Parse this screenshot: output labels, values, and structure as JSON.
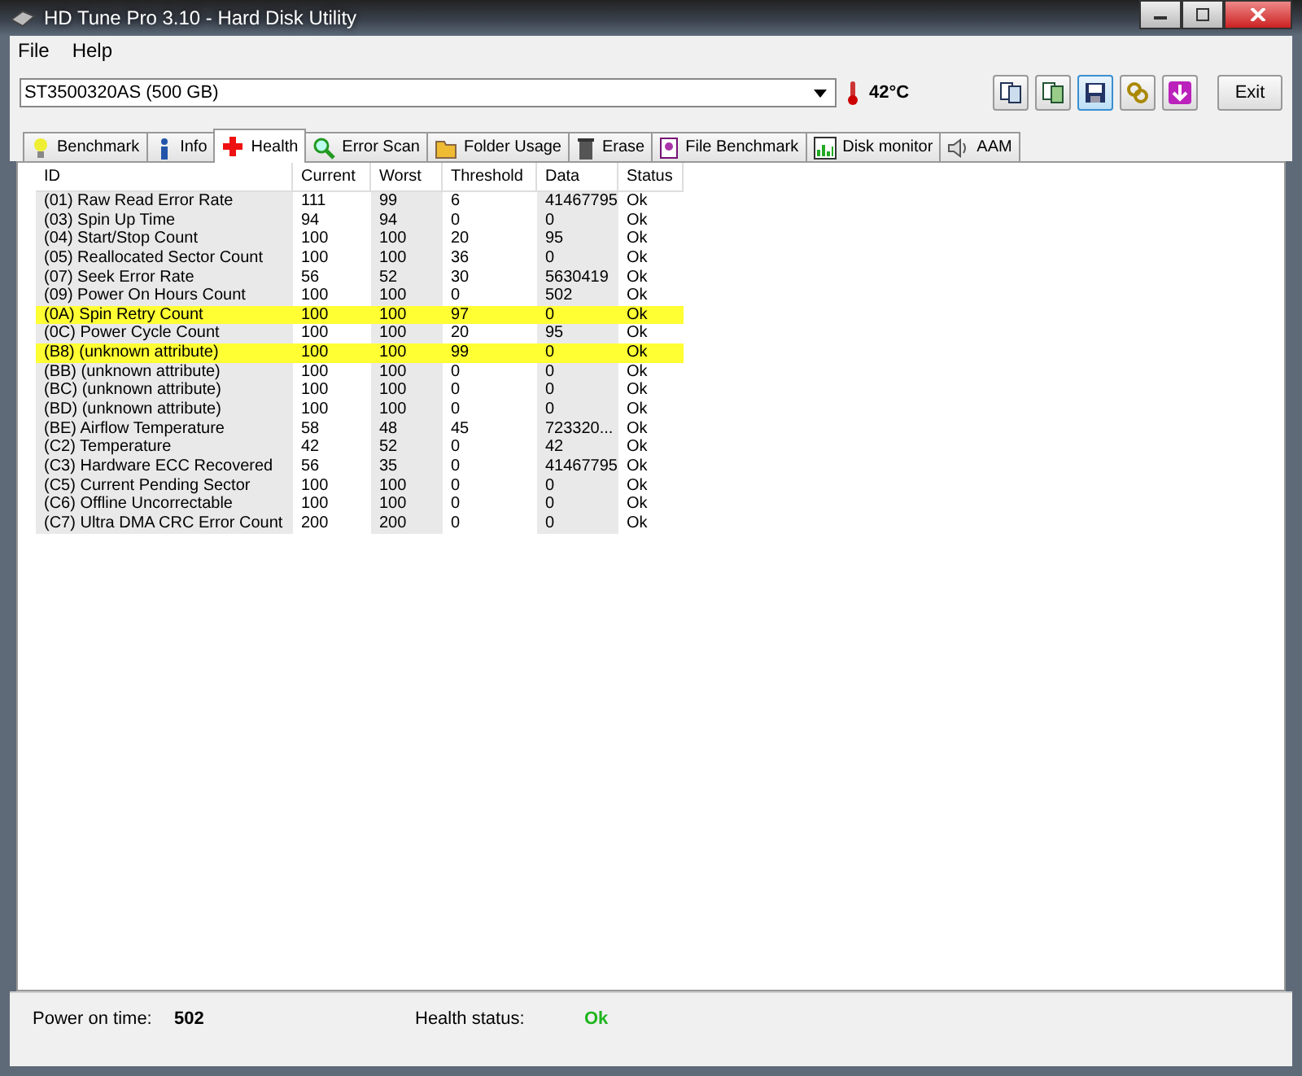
{
  "window": {
    "title": "HD Tune Pro 3.10 - Hard Disk Utility"
  },
  "menu": [
    "File",
    "Help"
  ],
  "drive": {
    "value": "ST3500320AS (500 GB)",
    "temperature": "42°C"
  },
  "toolbar": {
    "buttons": [
      {
        "highlighted": false
      },
      {
        "highlighted": false
      },
      {
        "highlighted": true
      },
      {
        "highlighted": false
      },
      {
        "highlighted": false
      }
    ],
    "exit": "Exit"
  },
  "tabs": [
    {
      "label": "Benchmark",
      "selected": false
    },
    {
      "label": "Info",
      "selected": false
    },
    {
      "label": "Health",
      "selected": true
    },
    {
      "label": "Error Scan",
      "selected": false
    },
    {
      "label": "Folder Usage",
      "selected": false
    },
    {
      "label": "Erase",
      "selected": false
    },
    {
      "label": "File Benchmark",
      "selected": false
    },
    {
      "label": "Disk monitor",
      "selected": false
    },
    {
      "label": "AAM",
      "selected": false
    }
  ],
  "table": {
    "columns": [
      "ID",
      "Current",
      "Worst",
      "Threshold",
      "Data",
      "Status"
    ],
    "rows": [
      {
        "cells": [
          "(01) Raw Read Error Rate",
          "111",
          "99",
          "6",
          "41467795",
          "Ok"
        ],
        "highlighted": false
      },
      {
        "cells": [
          "(03) Spin Up Time",
          "94",
          "94",
          "0",
          "0",
          "Ok"
        ],
        "highlighted": false
      },
      {
        "cells": [
          "(04) Start/Stop Count",
          "100",
          "100",
          "20",
          "95",
          "Ok"
        ],
        "highlighted": false
      },
      {
        "cells": [
          "(05) Reallocated Sector Count",
          "100",
          "100",
          "36",
          "0",
          "Ok"
        ],
        "highlighted": false
      },
      {
        "cells": [
          "(07) Seek Error Rate",
          "56",
          "52",
          "30",
          "5630419",
          "Ok"
        ],
        "highlighted": false
      },
      {
        "cells": [
          "(09) Power On Hours Count",
          "100",
          "100",
          "0",
          "502",
          "Ok"
        ],
        "highlighted": false
      },
      {
        "cells": [
          "(0A) Spin Retry Count",
          "100",
          "100",
          "97",
          "0",
          "Ok"
        ],
        "highlighted": true
      },
      {
        "cells": [
          "(0C) Power Cycle Count",
          "100",
          "100",
          "20",
          "95",
          "Ok"
        ],
        "highlighted": false
      },
      {
        "cells": [
          "(B8) (unknown attribute)",
          "100",
          "100",
          "99",
          "0",
          "Ok"
        ],
        "highlighted": true
      },
      {
        "cells": [
          "(BB) (unknown attribute)",
          "100",
          "100",
          "0",
          "0",
          "Ok"
        ],
        "highlighted": false
      },
      {
        "cells": [
          "(BC) (unknown attribute)",
          "100",
          "100",
          "0",
          "0",
          "Ok"
        ],
        "highlighted": false
      },
      {
        "cells": [
          "(BD) (unknown attribute)",
          "100",
          "100",
          "0",
          "0",
          "Ok"
        ],
        "highlighted": false
      },
      {
        "cells": [
          "(BE) Airflow Temperature",
          "58",
          "48",
          "45",
          "723320...",
          "Ok"
        ],
        "highlighted": false
      },
      {
        "cells": [
          "(C2) Temperature",
          "42",
          "52",
          "0",
          "42",
          "Ok"
        ],
        "highlighted": false
      },
      {
        "cells": [
          "(C3) Hardware ECC Recovered",
          "56",
          "35",
          "0",
          "41467795",
          "Ok"
        ],
        "highlighted": false
      },
      {
        "cells": [
          "(C5) Current Pending Sector",
          "100",
          "100",
          "0",
          "0",
          "Ok"
        ],
        "highlighted": false
      },
      {
        "cells": [
          "(C6) Offline Uncorrectable",
          "100",
          "100",
          "0",
          "0",
          "Ok"
        ],
        "highlighted": false
      },
      {
        "cells": [
          "(C7) Ultra DMA CRC Error Count",
          "200",
          "200",
          "0",
          "0",
          "Ok"
        ],
        "highlighted": false
      }
    ]
  },
  "footer": {
    "power_on_label": "Power on time:",
    "power_on_value": "502",
    "health_label": "Health status:",
    "health_value": "Ok"
  }
}
